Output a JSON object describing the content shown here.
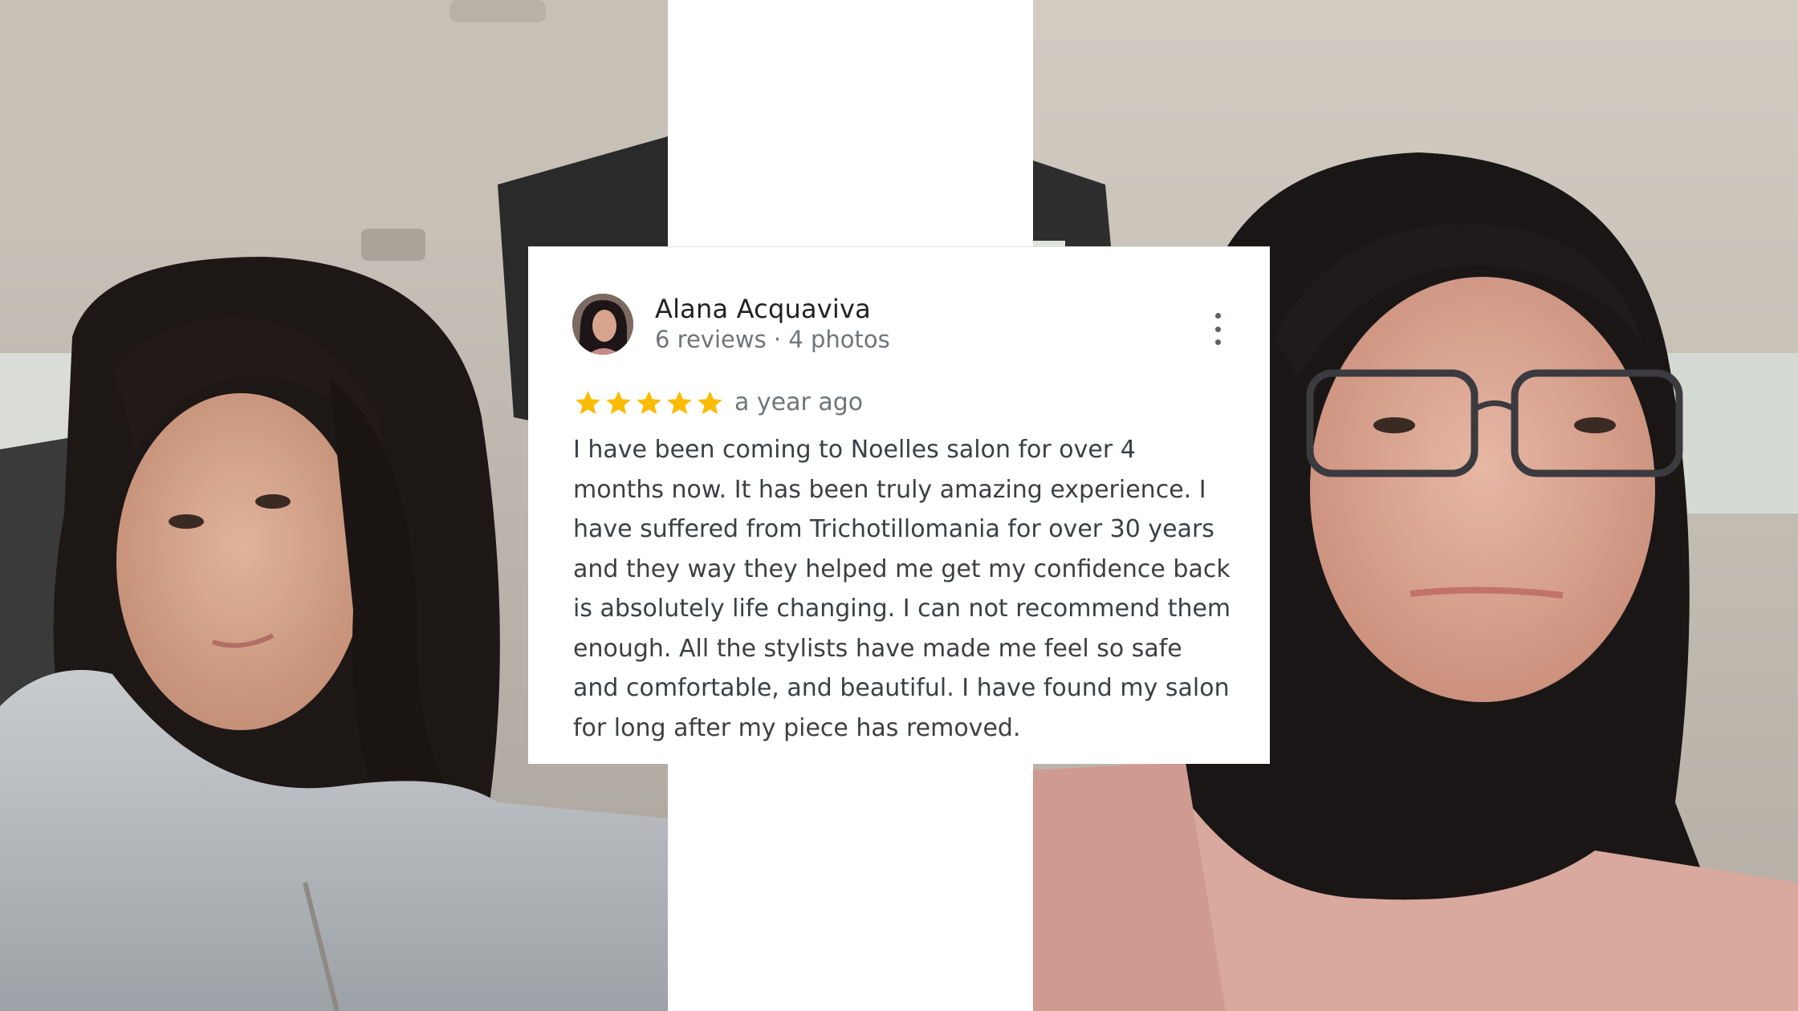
{
  "review": {
    "reviewer_name": "Alana Acquaviva",
    "reviewer_meta": "6 reviews · 4 photos",
    "rating": 5,
    "rating_max": 5,
    "star_color": "#fbbc04",
    "date": "a year ago",
    "text": "I have been coming to Noelles salon for over 4 months now. It has been truly amazing experience. I have suffered from Trichotillomania for over 30 years and they way they helped me get my confidence back is absolutely life changing. I can not recommend them enough. All the stylists have made me feel so safe and comfortable, and beautiful. I have found my salon for long after my piece has removed.",
    "menu_icon": "more-vert-icon"
  }
}
